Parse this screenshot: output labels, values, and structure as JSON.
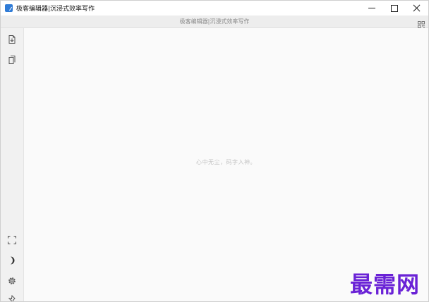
{
  "window": {
    "title": "极客编辑器|沉浸式效率写作"
  },
  "doc_bar": {
    "title": "极客编辑器|沉浸式效率写作"
  },
  "editor": {
    "placeholder": "心中无尘，码字入神。"
  },
  "watermark": {
    "text": "最需网"
  },
  "icons": {
    "app": "app-icon",
    "minimize": "minimize-icon",
    "maximize": "maximize-icon",
    "close": "close-icon",
    "qr": "qr-code-icon",
    "sidebar": [
      "new-file-icon",
      "copy-file-icon",
      "fullscreen-icon",
      "moon-icon",
      "gear-icon",
      "pin-icon"
    ]
  },
  "colors": {
    "accent": "#2f7bd6",
    "watermark": "#6a22d6"
  }
}
